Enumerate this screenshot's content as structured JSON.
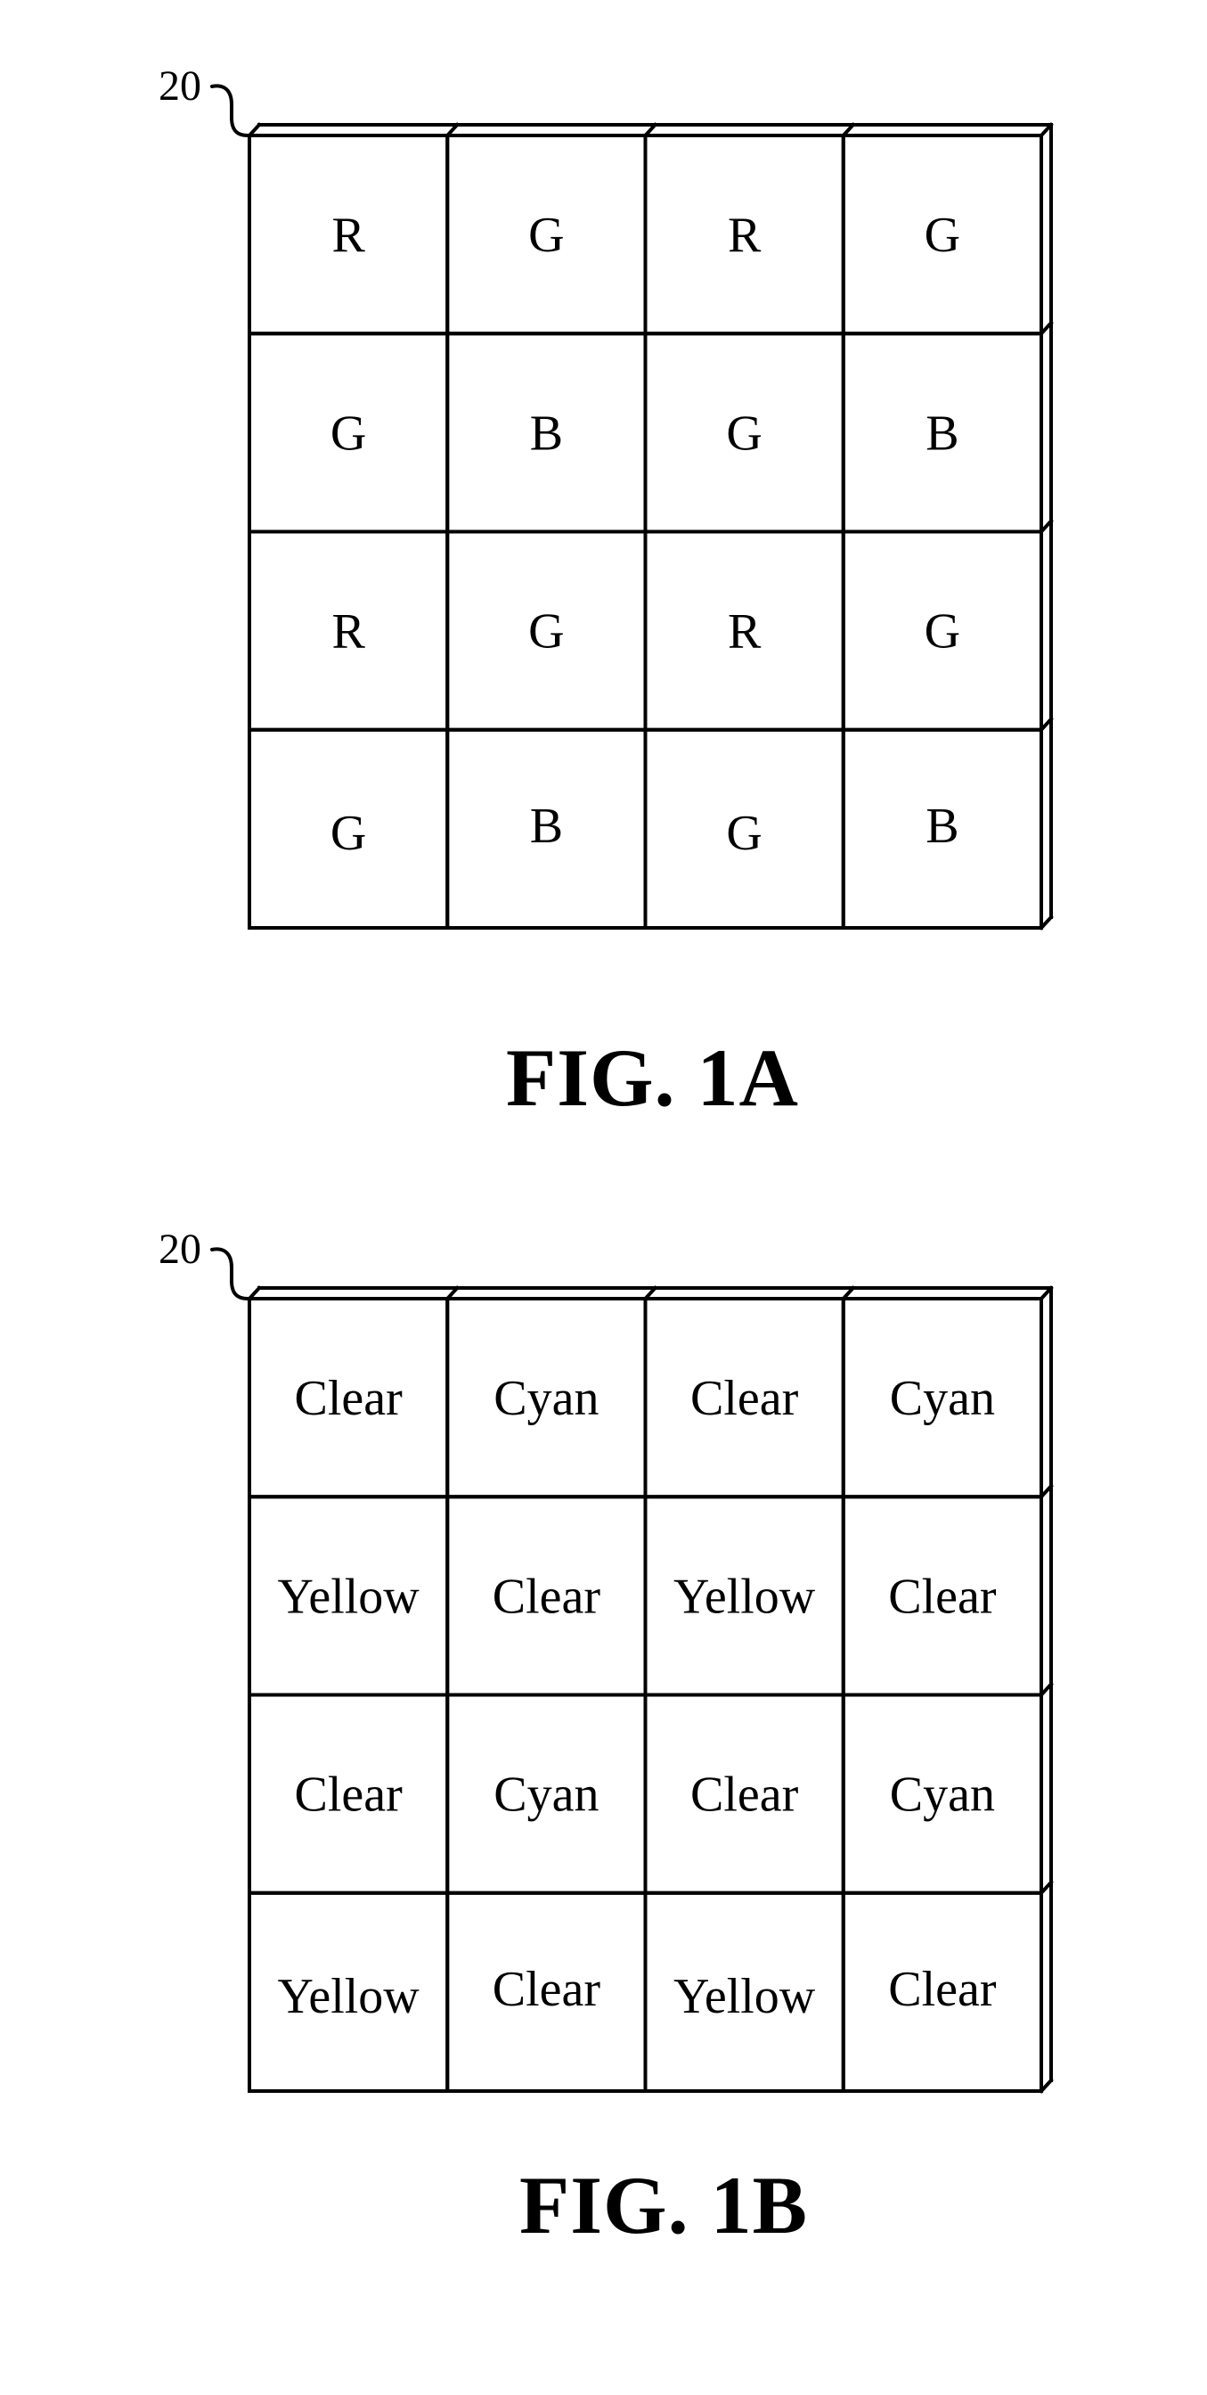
{
  "figures": [
    {
      "id": "fig-a",
      "caption": "FIG. 1A",
      "reference_numeral": "20",
      "rows": [
        [
          "R",
          "G",
          "R",
          "G"
        ],
        [
          "G",
          "B",
          "G",
          "B"
        ],
        [
          "R",
          "G",
          "R",
          "G"
        ],
        [
          "G",
          "B",
          "G",
          "B"
        ]
      ]
    },
    {
      "id": "fig-b",
      "caption": "FIG. 1B",
      "reference_numeral": "20",
      "rows": [
        [
          "Clear",
          "Cyan",
          "Clear",
          "Cyan"
        ],
        [
          "Yellow",
          "Clear",
          "Yellow",
          "Clear"
        ],
        [
          "Clear",
          "Cyan",
          "Clear",
          "Cyan"
        ],
        [
          "Yellow",
          "Clear",
          "Yellow",
          "Clear"
        ]
      ]
    }
  ],
  "colors": {
    "line": "#000000",
    "background": "#ffffff"
  }
}
